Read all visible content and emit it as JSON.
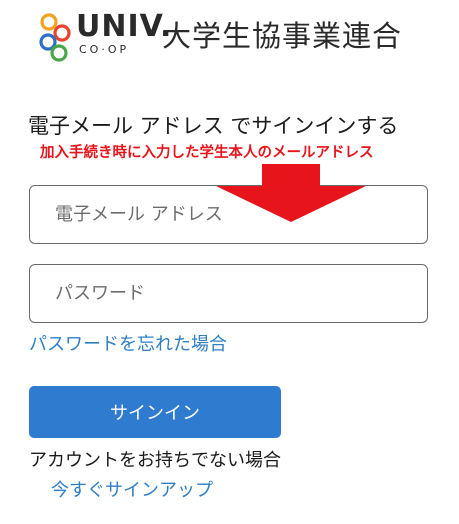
{
  "header": {
    "brand_univ": "UNIV.",
    "brand_coop": "CO·OP",
    "brand_org": "大学生協事業連合",
    "logo_icon": "coop-circles-logo-icon",
    "logo_colors": [
      "#e9442b",
      "#f3a21b",
      "#2b6fc9",
      "#49a547"
    ]
  },
  "signin": {
    "heading": "電子メール アドレス でサインインする",
    "annotation": "加入手続き時に入力した学生本人のメールアドレス",
    "annotation_color": "#e8141b",
    "email_placeholder": "電子メール アドレス",
    "email_value": "",
    "password_placeholder": "パスワード",
    "password_value": "",
    "forgot_link": "パスワードを忘れた場合",
    "signin_button": "サインイン",
    "no_account_text": "アカウントをお持ちでない場合",
    "signup_link": "今すぐサインアップ"
  },
  "colors": {
    "link": "#2f7fc3",
    "button": "#2f7bd0",
    "arrow": "#e8141b"
  }
}
